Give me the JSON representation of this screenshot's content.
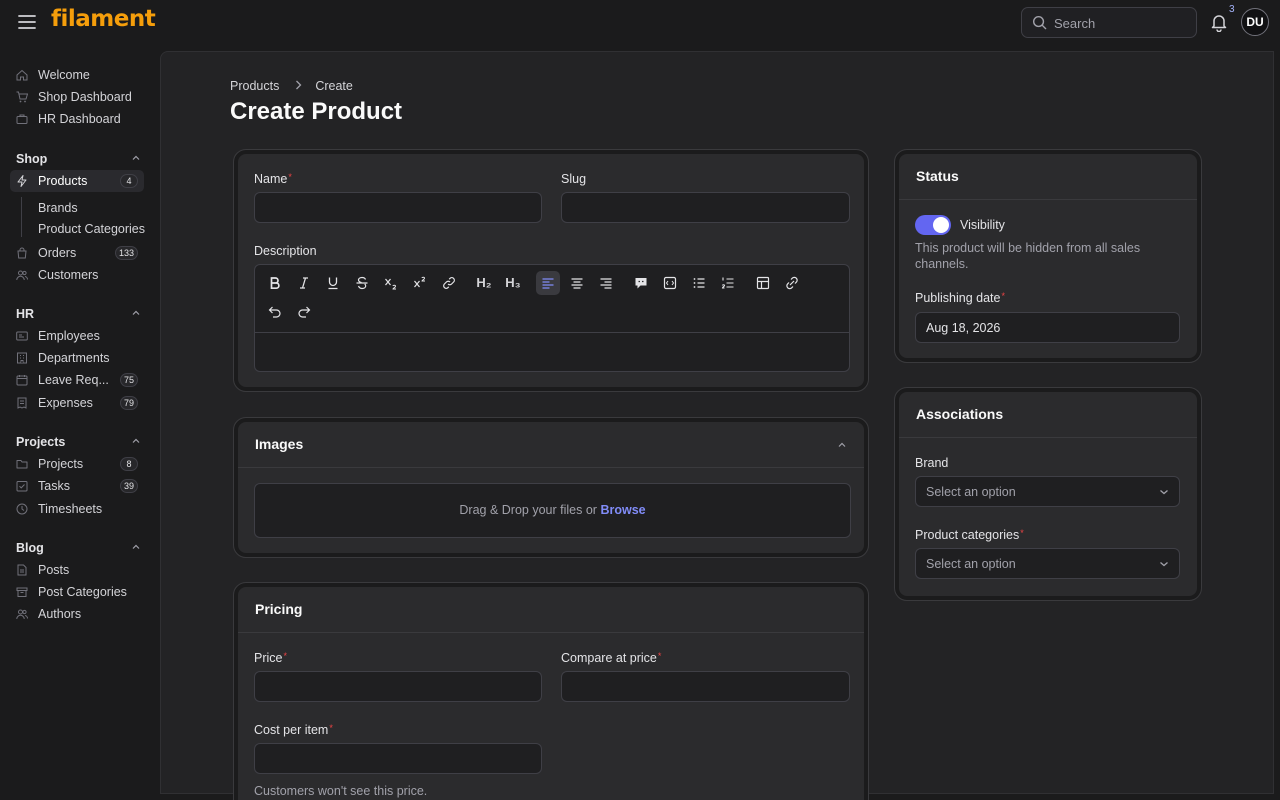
{
  "app": {
    "brand": "filament",
    "notification_count": "3",
    "user_initials": "DU"
  },
  "search": {
    "placeholder": "Search"
  },
  "sidebar": {
    "top_items": [
      {
        "label": "Welcome",
        "icon": "home-icon"
      },
      {
        "label": "Shop Dashboard",
        "icon": "cart-icon"
      },
      {
        "label": "HR Dashboard",
        "icon": "briefcase-icon"
      }
    ],
    "groups": {
      "shop": {
        "title": "Shop",
        "products": {
          "label": "Products",
          "badge": "4"
        },
        "sub_items": [
          "Brands",
          "Product Categories"
        ],
        "orders": {
          "label": "Orders",
          "badge": "133"
        },
        "customers": {
          "label": "Customers"
        }
      },
      "hr": {
        "title": "HR",
        "items": [
          {
            "label": "Employees",
            "badge": ""
          },
          {
            "label": "Departments",
            "badge": ""
          },
          {
            "label": "Leave Req...",
            "badge": "75"
          },
          {
            "label": "Expenses",
            "badge": "79"
          }
        ]
      },
      "projects": {
        "title": "Projects",
        "items": [
          {
            "label": "Projects",
            "badge": "8"
          },
          {
            "label": "Tasks",
            "badge": "39"
          },
          {
            "label": "Timesheets",
            "badge": ""
          }
        ]
      },
      "blog": {
        "title": "Blog",
        "items": [
          {
            "label": "Posts"
          },
          {
            "label": "Post Categories"
          },
          {
            "label": "Authors"
          }
        ]
      }
    }
  },
  "breadcrumb": {
    "items": [
      "Products",
      "Create"
    ]
  },
  "page": {
    "title": "Create Product"
  },
  "form": {
    "name_label": "Name",
    "slug_label": "Slug",
    "description_label": "Description",
    "required_mark": "*"
  },
  "images": {
    "title": "Images",
    "drop_text": "Drag & Drop your files or ",
    "browse_label": "Browse"
  },
  "pricing": {
    "title": "Pricing",
    "price_label": "Price",
    "compare_label": "Compare at price",
    "cost_label": "Cost per item",
    "cost_help": "Customers won't see this price."
  },
  "status": {
    "title": "Status",
    "visibility_label": "Visibility",
    "visibility_on": true,
    "visibility_help": "This product will be hidden from all sales channels.",
    "publish_label": "Publishing date",
    "publish_value": "Aug 18, 2026"
  },
  "associations": {
    "title": "Associations",
    "brand_label": "Brand",
    "brand_placeholder": "Select an option",
    "categories_label": "Product categories",
    "categories_placeholder": "Select an option"
  },
  "colors": {
    "accent": "#6366f1",
    "brand": "#f59e0b",
    "link": "#818cf8",
    "required": "#ef4444"
  }
}
